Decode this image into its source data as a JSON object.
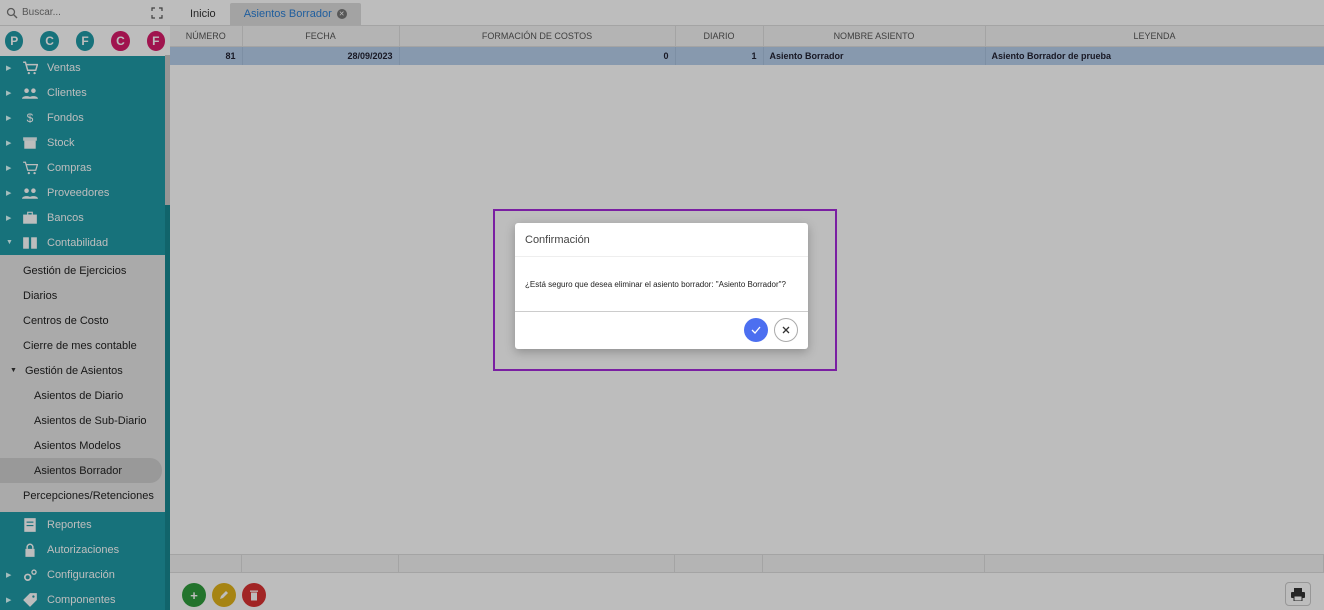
{
  "sidebar": {
    "search_placeholder": "Buscar...",
    "shortcuts": [
      {
        "letter": "P",
        "color": "#1f9aa6"
      },
      {
        "letter": "C",
        "color": "#1f9aa6"
      },
      {
        "letter": "F",
        "color": "#1f9aa6"
      },
      {
        "letter": "C",
        "color": "#d81b6a"
      },
      {
        "letter": "F",
        "color": "#d81b6a"
      }
    ],
    "menu": {
      "ventas": "Ventas",
      "clientes": "Clientes",
      "fondos": "Fondos",
      "stock": "Stock",
      "compras": "Compras",
      "proveedores": "Proveedores",
      "bancos": "Bancos",
      "contabilidad": "Contabilidad",
      "reportes": "Reportes",
      "autorizaciones": "Autorizaciones",
      "configuracion": "Configuración",
      "componentes": "Componentes"
    },
    "contabilidad_sub": {
      "gestion_ejercicios": "Gestión de Ejercicios",
      "diarios": "Diarios",
      "centros_costo": "Centros de Costo",
      "cierre_mes": "Cierre de mes contable",
      "gestion_asientos": "Gestión de Asientos",
      "asientos_diario": "Asientos de Diario",
      "asientos_subdiario": "Asientos de Sub-Diario",
      "asientos_modelos": "Asientos Modelos",
      "asientos_borrador": "Asientos Borrador",
      "percepciones": "Percepciones/Retenciones"
    }
  },
  "tabs": {
    "inicio": "Inicio",
    "asientos_borrador": "Asientos Borrador"
  },
  "grid": {
    "headers": {
      "numero": "NÚMERO",
      "fecha": "FECHA",
      "formacion": "FORMACIÓN DE COSTOS",
      "diario": "DIARIO",
      "nombre": "NOMBRE ASIENTO",
      "leyenda": "LEYENDA"
    },
    "row": {
      "numero": "81",
      "fecha": "28/09/2023",
      "formacion": "0",
      "diario": "1",
      "nombre": "Asiento Borrador",
      "leyenda": "Asiento Borrador de prueba"
    }
  },
  "dialog": {
    "title": "Confirmación",
    "message": "¿Está seguro que desea eliminar el asiento borrador: \"Asiento Borrador\"?",
    "confirm_icon": "check-icon",
    "cancel_icon": "close-icon"
  },
  "colors": {
    "sidebar_bg": "#1f9aa6",
    "selected_row": "#b6cfeb",
    "confirm_button": "#4c6ff0",
    "highlight_border": "#7a1fa2"
  }
}
